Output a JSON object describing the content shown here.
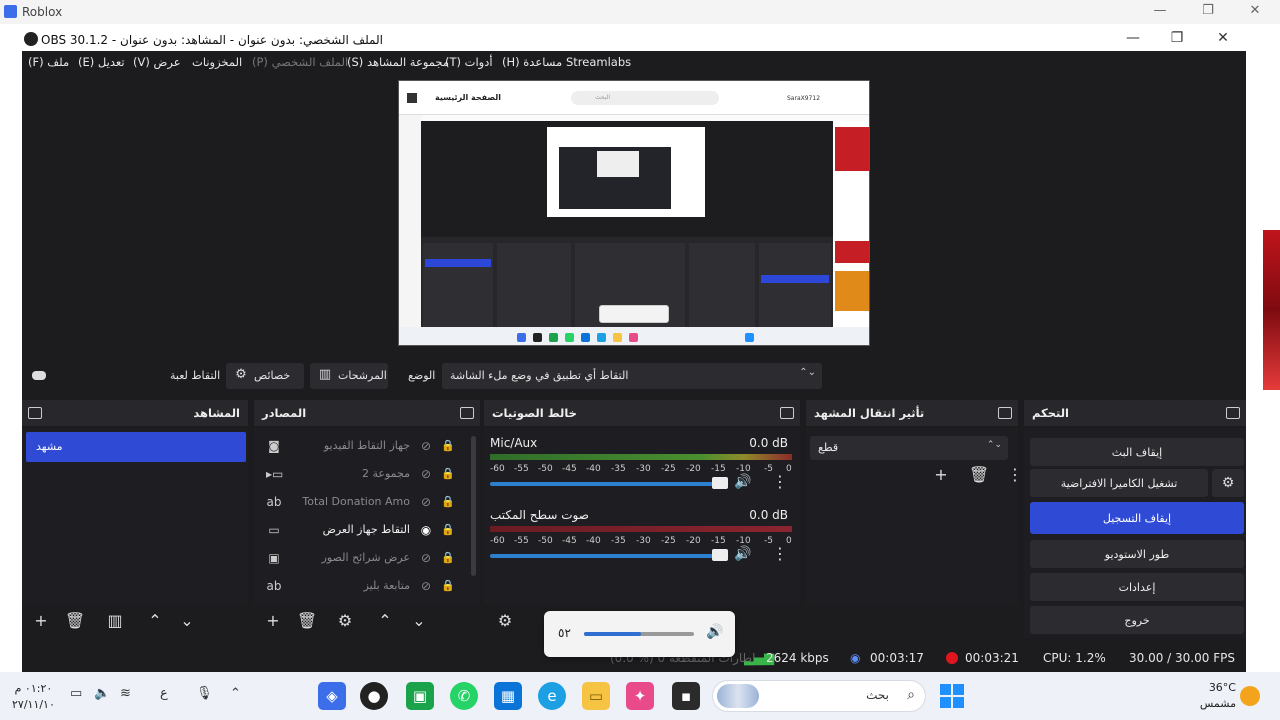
{
  "roblox": {
    "title": "Roblox"
  },
  "obs": {
    "title": "OBS 30.1.2 - الملف الشخصي: بدون عنوان - المشاهد: بدون عنوان",
    "menu": [
      "(F) ملف",
      "(E) تعديل",
      "(V) عرض",
      "المخزونات",
      "(P) الملف الشخصي",
      "(S) مجموعة المشاهد",
      "(T) أدوات",
      "(H) مساعدة",
      "Streamlabs"
    ],
    "preview": {
      "page_title": "الصفحة الرئيسية",
      "search_placeholder": "البحث",
      "username": "SaraX9712"
    },
    "source_toolbar": {
      "game_capture": "التقاط لعبة",
      "properties": "خصائص",
      "filters": "المرشحات",
      "mode_label": "الوضع",
      "mode_value": "التقاط أي تطبيق في وضع ملء الشاشة"
    },
    "scenes": {
      "title": "المشاهد",
      "items": [
        "مشهد"
      ]
    },
    "sources": {
      "title": "المصادر",
      "items": [
        {
          "name": "جهاز التقاط الفيديو",
          "icon": "camera-icon",
          "visible": false
        },
        {
          "name": "مجموعة 2",
          "icon": "folder-icon",
          "visible": false
        },
        {
          "name": "Total Donation Amo",
          "icon": "text-icon",
          "visible": false
        },
        {
          "name": "التقاط جهاز العرض",
          "icon": "monitor-icon",
          "visible": true
        },
        {
          "name": "عرض شرائح الصور",
          "icon": "slideshow-icon",
          "visible": false
        },
        {
          "name": "متابعة بليز",
          "icon": "text-icon",
          "visible": false
        }
      ]
    },
    "mixer": {
      "title": "خالط الصوتيات",
      "channels": [
        {
          "name": "Mic/Aux",
          "db": "0.0 dB"
        },
        {
          "name": "صوت سطح المكتب",
          "db": "0.0 dB"
        }
      ],
      "ticks": [
        "-60",
        "-55",
        "-50",
        "-45",
        "-40",
        "-35",
        "-30",
        "-25",
        "-20",
        "-15",
        "-10",
        "-5",
        "0"
      ]
    },
    "transitions": {
      "title": "تأثير انتقال المشهد",
      "value": "قطع"
    },
    "controls": {
      "title": "التحكم",
      "stop_stream": "إيقاف البث",
      "virtual_camera": "تشغيل الكاميرا الافتراضية",
      "stop_recording": "إيقاف التسجيل",
      "studio_mode": "طور الاستوديو",
      "settings": "إعدادات",
      "exit": "خروج"
    },
    "status": {
      "dropped": "(0.0 %) 0 إطارات المتقطعة",
      "bitrate": "2624 kbps",
      "stream_time": "00:03:17",
      "rec_time": "00:03:21",
      "cpu": "CPU: 1.2%",
      "fps": "30.00 / 30.00 FPS"
    }
  },
  "volume_flyout": {
    "level": "٥٢",
    "level_fraction": 0.52
  },
  "taskbar": {
    "time": "٠١:٢٠ م",
    "date": "٢٧/١١/١٠",
    "lang": "ع",
    "search_label": "بحث",
    "temperature": "36°C",
    "weather": "مشمس"
  },
  "colors": {
    "accent": "#2f4bd6",
    "recording": "#e0161e",
    "streaming": "#5b8df6",
    "bitrate": "#39b54a"
  }
}
